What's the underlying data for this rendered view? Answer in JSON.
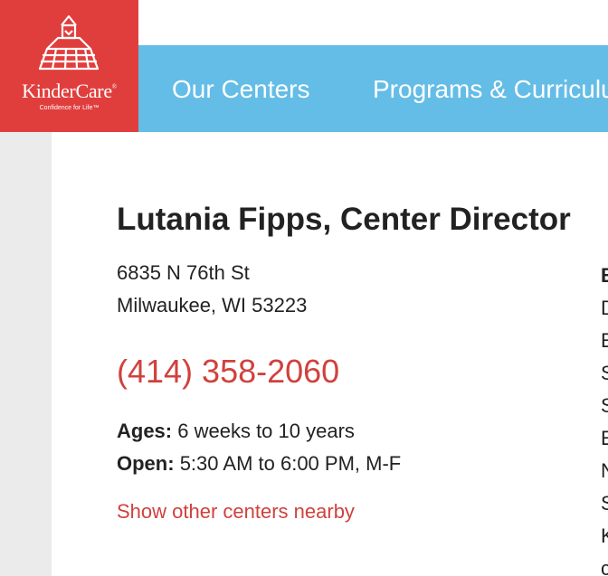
{
  "brand": {
    "name": "KinderCare",
    "registered": "®",
    "tagline": "Confidence for Life™"
  },
  "nav": {
    "items": [
      {
        "label": "Our Centers"
      },
      {
        "label": "Programs & Curriculum"
      }
    ]
  },
  "center": {
    "title": "Lutania Fipps, Center Director",
    "address_line1": "6835 N 76th St",
    "address_line2": "Milwaukee, WI 53223",
    "phone": "(414) 358-2060",
    "ages_label": "Ages:",
    "ages_value": "6 weeks to 10 years",
    "open_label": "Open:",
    "open_value": "5:30 AM to 6:00 PM, M-F",
    "nearby_link": "Show other centers nearby"
  },
  "right_column": {
    "letters": [
      "B",
      "D",
      "E",
      "S",
      "S",
      "E",
      "N",
      "S",
      "K",
      "c"
    ]
  },
  "colors": {
    "brand_red": "#e03e3d",
    "nav_blue": "#64bde6",
    "link_red": "#d0413d"
  }
}
